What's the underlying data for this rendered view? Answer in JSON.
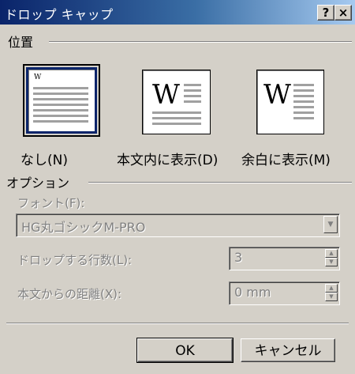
{
  "window": {
    "title": "ドロップ キャップ",
    "help_label": "?",
    "close_label": "×"
  },
  "position": {
    "group_label": "位置",
    "options": [
      {
        "label": "なし(N)",
        "selected": true
      },
      {
        "label": "本文内に表示(D)",
        "selected": false
      },
      {
        "label": "余白に表示(M)",
        "selected": false
      }
    ],
    "tile_letter": "W"
  },
  "options": {
    "group_label": "オプション",
    "font_label": "フォント(F):",
    "font_value": "HG丸ゴシックM-PRO",
    "lines_label": "ドロップする行数(L):",
    "lines_value": "3",
    "distance_label": "本文からの距離(X):",
    "distance_value": "0 mm"
  },
  "buttons": {
    "ok": "OK",
    "cancel": "キャンセル"
  }
}
